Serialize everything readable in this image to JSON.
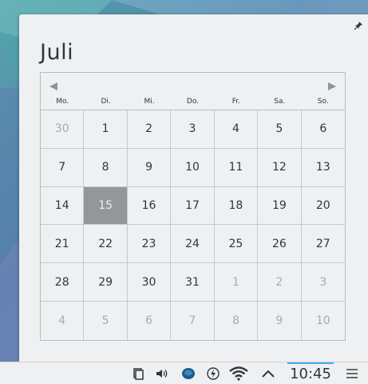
{
  "calendar": {
    "month": "Juli",
    "weekdays": [
      "Mo.",
      "Di.",
      "Mi.",
      "Do.",
      "Fr.",
      "Sa.",
      "So."
    ],
    "today": "15",
    "days": [
      {
        "d": "30",
        "other": true
      },
      {
        "d": "1"
      },
      {
        "d": "2"
      },
      {
        "d": "3"
      },
      {
        "d": "4"
      },
      {
        "d": "5"
      },
      {
        "d": "6"
      },
      {
        "d": "7"
      },
      {
        "d": "8"
      },
      {
        "d": "9"
      },
      {
        "d": "10"
      },
      {
        "d": "11"
      },
      {
        "d": "12"
      },
      {
        "d": "13"
      },
      {
        "d": "14"
      },
      {
        "d": "15",
        "today": true
      },
      {
        "d": "16"
      },
      {
        "d": "17"
      },
      {
        "d": "18"
      },
      {
        "d": "19"
      },
      {
        "d": "20"
      },
      {
        "d": "21"
      },
      {
        "d": "22"
      },
      {
        "d": "23"
      },
      {
        "d": "24"
      },
      {
        "d": "25"
      },
      {
        "d": "26"
      },
      {
        "d": "27"
      },
      {
        "d": "28"
      },
      {
        "d": "29"
      },
      {
        "d": "30"
      },
      {
        "d": "31"
      },
      {
        "d": "1",
        "other": true
      },
      {
        "d": "2",
        "other": true
      },
      {
        "d": "3",
        "other": true
      },
      {
        "d": "4",
        "other": true
      },
      {
        "d": "5",
        "other": true
      },
      {
        "d": "6",
        "other": true
      },
      {
        "d": "7",
        "other": true
      },
      {
        "d": "8",
        "other": true
      },
      {
        "d": "9",
        "other": true
      },
      {
        "d": "10",
        "other": true
      }
    ],
    "icons": {
      "prev": "chevron-left-icon",
      "next": "chevron-right-icon",
      "pin": "pin-icon"
    }
  },
  "panel": {
    "clock": "10:45",
    "tray_icons": [
      "clipboard-icon",
      "volume-icon",
      "messenger-icon",
      "power-icon",
      "wifi-icon",
      "chevron-up-icon",
      "menu-icon"
    ]
  },
  "colors": {
    "accent": "#3daee9",
    "today_bg": "#93979b",
    "popup_bg": "#eef0f1",
    "text": "#31363b",
    "muted_text": "#a8acaf"
  }
}
